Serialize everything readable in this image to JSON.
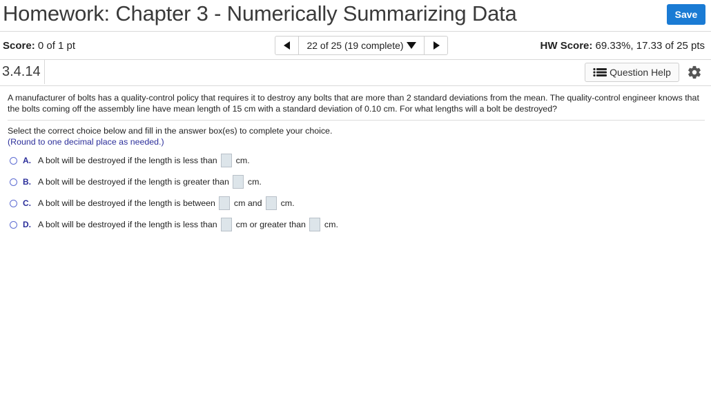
{
  "header": {
    "title": "Homework: Chapter 3 - Numerically Summarizing Data",
    "save_label": "Save"
  },
  "score_bar": {
    "score_label": "Score:",
    "score_value": "0 of 1 pt",
    "nav_text": "22 of 25 (19 complete)",
    "hw_label": "HW Score:",
    "hw_value": "69.33%, 17.33 of 25 pts"
  },
  "question_bar": {
    "question_id": "3.4.14",
    "help_label": "Question Help"
  },
  "question": {
    "text": "A manufacturer of bolts has a quality-control policy that requires it to destroy any bolts that are more than 2 standard deviations from the mean. The quality-control engineer knows that the bolts coming off the assembly line have mean length of 15 cm with a standard deviation of 0.10 cm. For what lengths will a bolt be destroyed?",
    "instruction": "Select the correct choice below and fill in the answer box(es) to complete your choice.",
    "round_note": "(Round to one decimal place as needed.)"
  },
  "choices": {
    "a": {
      "letter": "A.",
      "text1": "A bolt will be destroyed if the length is less than",
      "text2": "cm."
    },
    "b": {
      "letter": "B.",
      "text1": "A bolt will be destroyed if the length is greater than",
      "text2": "cm."
    },
    "c": {
      "letter": "C.",
      "text1": "A bolt will be destroyed if the length is between",
      "text2": "cm and",
      "text3": "cm."
    },
    "d": {
      "letter": "D.",
      "text1": "A bolt will be destroyed if the length is less than",
      "text2": "cm or greater than",
      "text3": "cm."
    }
  },
  "colors": {
    "accent": "#1a7bd4",
    "choice_letter": "#2b2e9a"
  },
  "icons": [
    "prev-arrow-icon",
    "caret-down-icon",
    "next-arrow-icon",
    "list-icon",
    "gear-icon",
    "radio-icon"
  ]
}
